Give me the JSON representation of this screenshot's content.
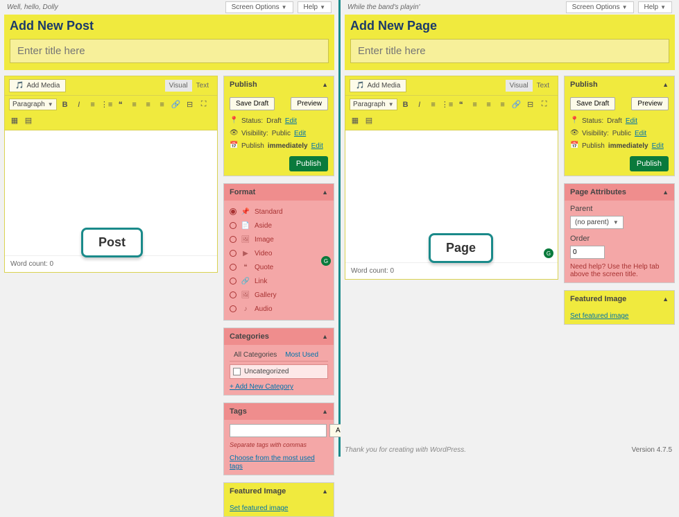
{
  "left": {
    "greeting": "Well, hello, Dolly",
    "screen_options": "Screen Options",
    "help": "Help",
    "heading": "Add New Post",
    "title_placeholder": "Enter title here",
    "add_media": "Add Media",
    "tabs": {
      "visual": "Visual",
      "text": "Text"
    },
    "paragraph": "Paragraph",
    "word_count": "Word count: 0",
    "badge": "Post",
    "publish": {
      "title": "Publish",
      "save_draft": "Save Draft",
      "preview": "Preview",
      "status_label": "Status:",
      "status_value": "Draft",
      "visibility_label": "Visibility:",
      "visibility_value": "Public",
      "publish_label": "Publish",
      "publish_value": "immediately",
      "edit": "Edit",
      "button": "Publish"
    },
    "format": {
      "title": "Format",
      "items": [
        "Standard",
        "Aside",
        "Image",
        "Video",
        "Quote",
        "Link",
        "Gallery",
        "Audio"
      ],
      "selected": 0
    },
    "categories": {
      "title": "Categories",
      "all": "All Categories",
      "most": "Most Used",
      "item": "Uncategorized",
      "add_new": "+ Add New Category"
    },
    "tags": {
      "title": "Tags",
      "add": "Add",
      "hint": "Separate tags with commas",
      "choose": "Choose from the most used tags"
    },
    "featured": {
      "title": "Featured Image",
      "link": "Set featured image"
    }
  },
  "right": {
    "greeting": "While the band's playin'",
    "screen_options": "Screen Options",
    "help": "Help",
    "heading": "Add New Page",
    "title_placeholder": "Enter title here",
    "add_media": "Add Media",
    "tabs": {
      "visual": "Visual",
      "text": "Text"
    },
    "paragraph": "Paragraph",
    "word_count": "Word count: 0",
    "badge": "Page",
    "publish": {
      "title": "Publish",
      "save_draft": "Save Draft",
      "preview": "Preview",
      "status_label": "Status:",
      "status_value": "Draft",
      "visibility_label": "Visibility:",
      "visibility_value": "Public",
      "publish_label": "Publish",
      "publish_value": "immediately",
      "edit": "Edit",
      "button": "Publish"
    },
    "attributes": {
      "title": "Page Attributes",
      "parent_label": "Parent",
      "parent_value": "(no parent)",
      "order_label": "Order",
      "order_value": "0",
      "help": "Need help? Use the Help tab above the screen title."
    },
    "featured": {
      "title": "Featured Image",
      "link": "Set featured image"
    },
    "version": "Version 4.7.5",
    "thankyou": "Thank you for creating with WordPress."
  }
}
